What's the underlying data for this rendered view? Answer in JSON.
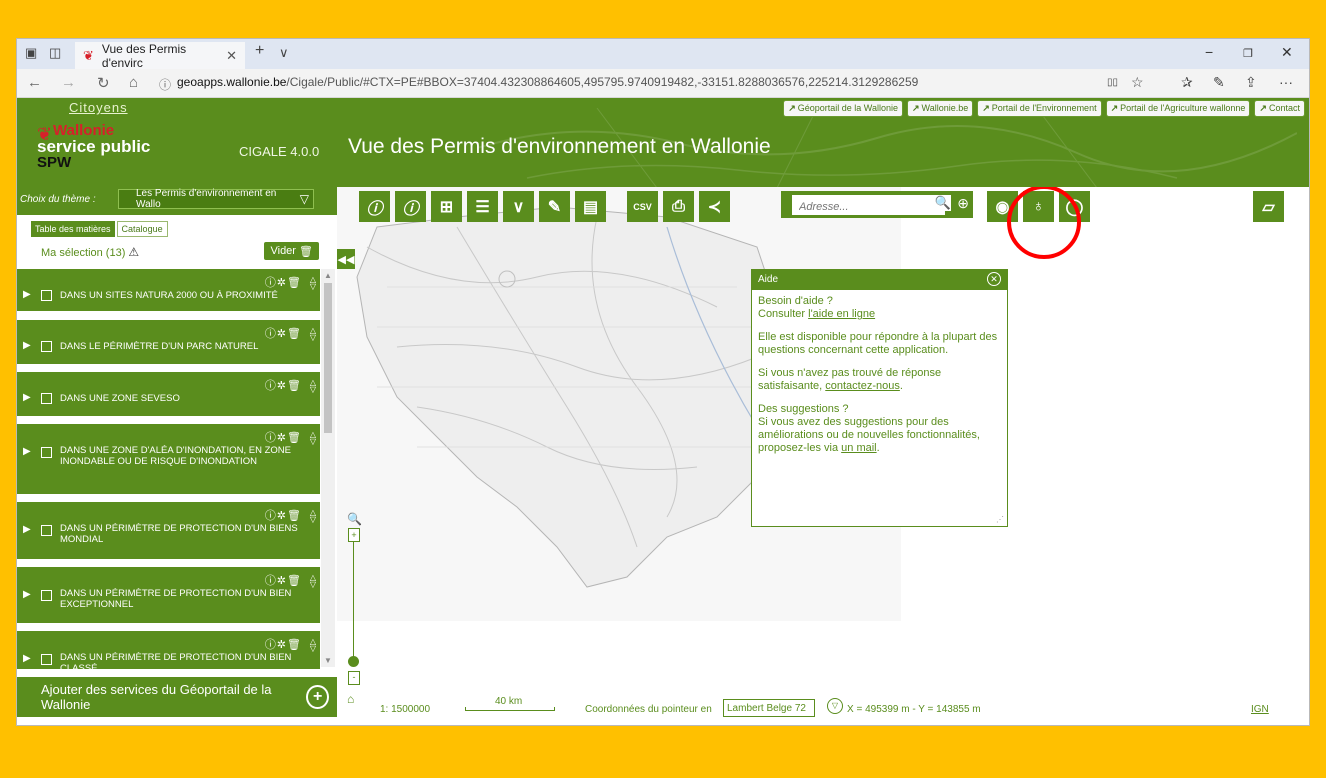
{
  "browser": {
    "tab_title": "Vue des Permis d'envirc",
    "tab_close": "✕",
    "new_tab": "+",
    "tab_menu": "∨",
    "url_domain": "geoapps.wallonie.be",
    "url_rest": "/Cigale/Public/#CTX=PE#BBOX=37404.432308864605,495795.9740919482,-33151.8288036576,225214.3129286259",
    "back": "←",
    "forward": "→",
    "refresh": "↻",
    "home": "⌂",
    "info": "ⓘ",
    "minimize": "−",
    "restore": "❐",
    "close": "✕",
    "reading": "▯▯",
    "favorite": "☆",
    "favorites_hub": "✰",
    "pen": "✎",
    "share": "⇪",
    "more": "···"
  },
  "header": {
    "citoyens": "Citoyens",
    "brand_line1": "Wallonie",
    "brand_line2": "service public",
    "brand_line3": "SPW",
    "version": "CIGALE 4.0.0",
    "title": "Vue des Permis d'environnement en Wallonie",
    "links": [
      "Géoportail de la Wallonie",
      "Wallonie.be",
      "Portail de l'Environnement",
      "Portail de l'Agriculture wallonne",
      "Contact"
    ]
  },
  "left": {
    "theme_label": "Choix du thème :",
    "theme_value": "Les Permis d'environnement en Wallo",
    "tab_toc": "Table des matières",
    "tab_catalog": "Catalogue",
    "selection": "Ma sélection (13)",
    "clear": "Vider",
    "layers": [
      "Dans un sites Natura 2000 ou à proximité",
      "Dans le périmètre d'un parc naturel",
      "Dans une zone Seveso",
      "Dans une zone d'aléa d'inondation, en zone inondable ou de risque d'inondation",
      "Dans un périmètre de protection d'un biens mondial",
      "Dans un périmètre de protection d'un bien exceptionnel",
      "Dans un périmètre de protection d'un bien classé"
    ],
    "add_services": "Ajouter des services du Géoportail de la Wallonie"
  },
  "map": {
    "address_placeholder": "Adresse...",
    "scale": "1: 1500000",
    "scale_bar": "40 km",
    "coord_label": "Coordonnées du pointeur en",
    "projection": "Lambert Belge 72",
    "coords": "X = 495399 m  - Y = 143855 m",
    "ign": "IGN"
  },
  "help": {
    "title": "Aide",
    "q1": "Besoin d'aide ?",
    "consult": "Consulter ",
    "consult_link": "l'aide en ligne",
    "available": "Elle est disponible pour répondre à la plupart des questions concernant cette application.",
    "notfound": "Si vous n'avez pas trouvé de réponse satisfaisante, ",
    "contact_link": "contactez-nous",
    "period": ".",
    "q2": "Des suggestions ?",
    "suggest": "Si vous avez des suggestions pour des améliorations ou de nouvelles fonctionnalités, proposez-les via ",
    "mail_link": "un mail",
    "period2": "."
  },
  "colors": {
    "accent": "#5a8d1d",
    "frame": "#ffc000",
    "highlight": "#ff0000"
  }
}
